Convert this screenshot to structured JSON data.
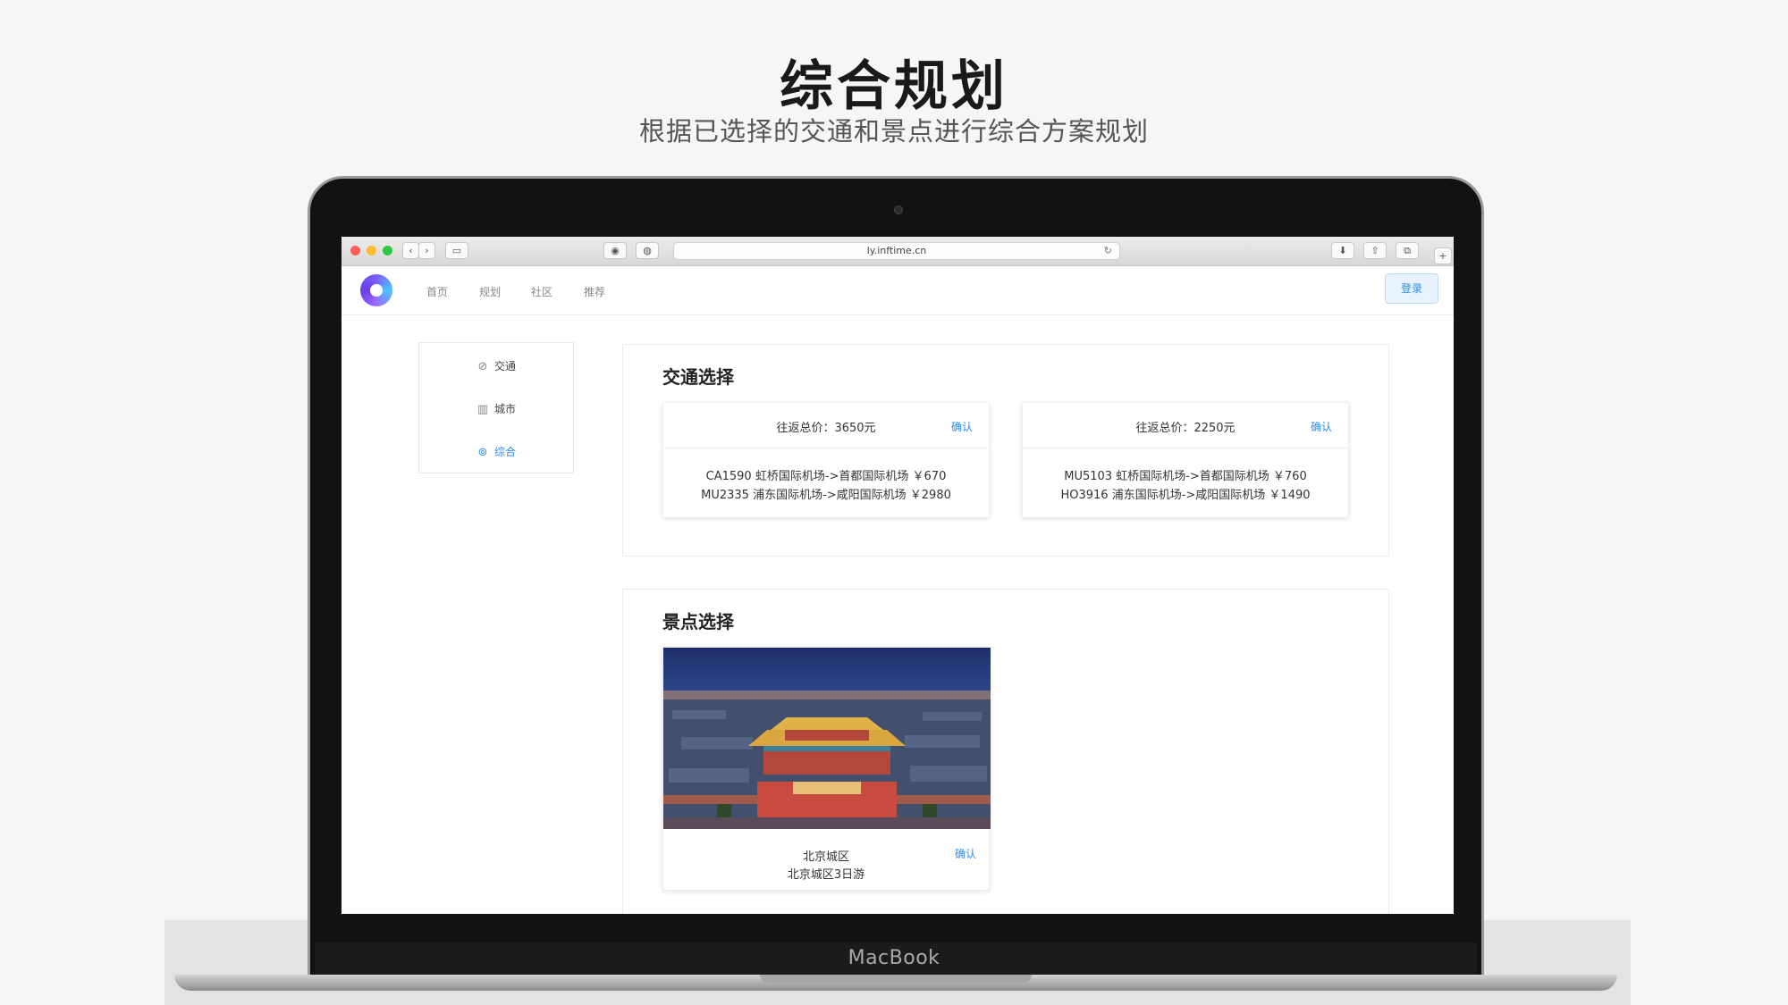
{
  "headline": "综合规划",
  "subheadline": "根据已选择的交通和景点进行综合方案规划",
  "device": {
    "brand": "MacBook"
  },
  "browser": {
    "url": "ly.inftime.cn",
    "icons": [
      "back-icon",
      "forward-icon",
      "sidebar-icon",
      "reader-icon",
      "privacy-icon",
      "reload-icon",
      "download-icon",
      "share-icon",
      "tabs-icon",
      "new-tab-icon"
    ]
  },
  "app": {
    "nav": [
      "首页",
      "规划",
      "社区",
      "推荐"
    ],
    "login_label": "登录",
    "side_menu": [
      {
        "label": "交通",
        "icon": "compass-icon",
        "active": false
      },
      {
        "label": "城市",
        "icon": "building-icon",
        "active": false
      },
      {
        "label": "综合",
        "icon": "map-pin-icon",
        "active": true
      }
    ],
    "transport": {
      "title": "交通选择",
      "options": [
        {
          "price": "往返总价：3650元",
          "confirm": "确认",
          "flights": [
            "CA1590 虹桥国际机场->首都国际机场 ￥670",
            "MU2335 浦东国际机场->咸阳国际机场 ￥2980"
          ]
        },
        {
          "price": "往返总价：2250元",
          "confirm": "确认",
          "flights": [
            "MU5103 虹桥国际机场->首都国际机场 ￥760",
            "HO3916 浦东国际机场->咸阳国际机场 ￥1490"
          ]
        }
      ]
    },
    "sights": {
      "title": "景点选择",
      "items": [
        {
          "name": "北京城区",
          "desc": "北京城区3日游",
          "confirm": "确认"
        }
      ]
    }
  },
  "colors": {
    "accent": "#2d8cf0",
    "bg": "#f6f6f6"
  }
}
